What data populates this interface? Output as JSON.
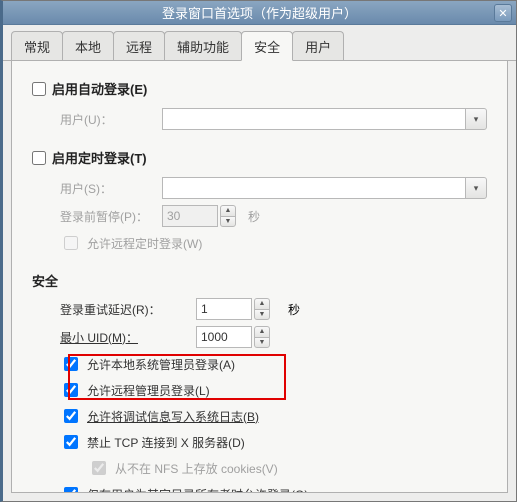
{
  "title": "登录窗口首选项（作为超级用户）",
  "tabs": [
    "常规",
    "本地",
    "远程",
    "辅助功能",
    "安全",
    "用户"
  ],
  "active_tab": 4,
  "auto_login": {
    "head": "启用自动登录(E)",
    "user_label": "用户(U)："
  },
  "timed_login": {
    "head": "启用定时登录(T)",
    "user_label": "用户(S)：",
    "pause_label": "登录前暂停(P)：",
    "pause_value": "30",
    "pause_unit": "秒",
    "allow_remote": "允许远程定时登录(W)"
  },
  "security": {
    "title": "安全",
    "retry_label": "登录重试延迟(R)：",
    "retry_value": "1",
    "retry_unit": "秒",
    "min_uid_label": "最小 UID(M)：",
    "min_uid_value": "1000",
    "allow_local_admin": "允许本地系统管理员登录(A)",
    "allow_remote_admin": "允许远程管理员登录(L)",
    "allow_syslog": "允许将调试信息写入系统日志(B)",
    "deny_tcp": "禁止 TCP 连接到 X 服务器(D)",
    "nfs_cookies": "从不在 NFS 上存放 cookies(V)",
    "home_owner": "仅在用户为其家目录所有者时允许登录(O)"
  }
}
